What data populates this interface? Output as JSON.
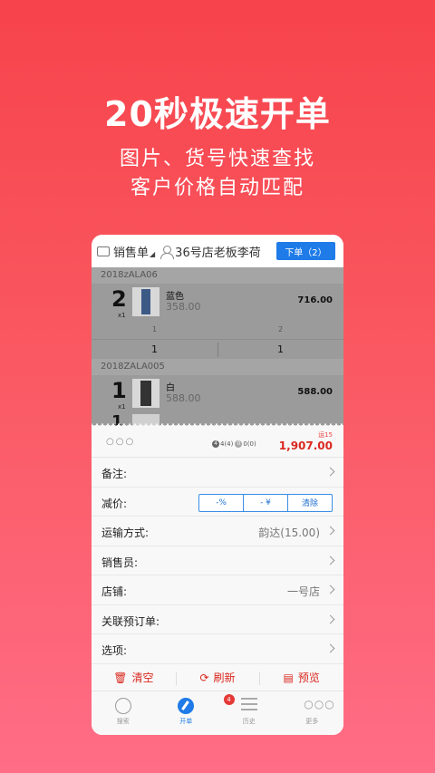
{
  "hero": {
    "title": "20秒极速开单",
    "subtitle_line1": "图片、货号快速查找",
    "subtitle_line2": "客户价格自动匹配"
  },
  "header": {
    "doc_type": "销售单",
    "customer": "36号店老板李荷",
    "order_button": "下单（2）"
  },
  "items": [
    {
      "sku": "2018zALA06",
      "qty": "2",
      "unit": "x1",
      "name": "蓝色",
      "price": "358.00",
      "total": "716.00",
      "sizes": [
        "1",
        "2"
      ],
      "counts": [
        "1",
        "1"
      ],
      "thumb_icon": "jeans-thumbnail"
    },
    {
      "sku": "2018ZALA005",
      "qty": "1",
      "unit": "x1",
      "name": "白",
      "price": "588.00",
      "total": "588.00",
      "thumb_icon": "pants-thumbnail"
    }
  ],
  "summary": {
    "dots": "○○○",
    "badge1_icon": "4",
    "badge1_text": "4(4)",
    "badge2_icon": "0",
    "badge2_text": "0(0)",
    "shipping_tag": "运15",
    "amount": "1,907.00"
  },
  "form": {
    "note_label": "备注:",
    "discount_label": "减价:",
    "discount_options": [
      "-%",
      "- ¥",
      "清除"
    ],
    "shipping_label": "运输方式:",
    "shipping_value": "韵达(15.00)",
    "salesperson_label": "销售员:",
    "store_label": "店铺:",
    "store_value": "一号店",
    "preorder_label": "关联预订单:",
    "options_label": "选项:"
  },
  "actions": {
    "clear": "清空",
    "refresh": "刷新",
    "preview": "预览"
  },
  "tabs": [
    {
      "label": "搜索",
      "icon": "search-icon"
    },
    {
      "label": "开单",
      "icon": "pen-icon",
      "badge": "4"
    },
    {
      "label": "历史",
      "icon": "list-icon"
    },
    {
      "label": "更多",
      "icon": "more-icon"
    }
  ],
  "colors": {
    "accent_blue": "#1e7be8",
    "accent_red": "#d9281f",
    "background_top": "#f7434b",
    "background_bottom": "#ff6d86"
  }
}
